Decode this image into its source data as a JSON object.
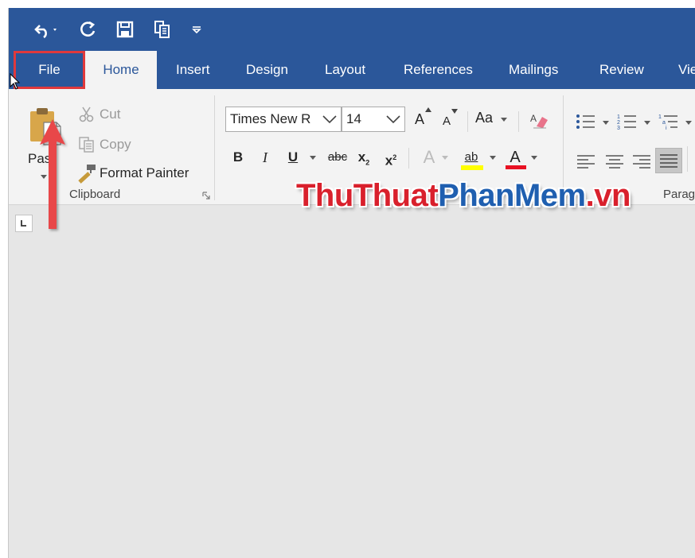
{
  "colors": {
    "title_bar": "#2b579a",
    "ribbon": "#f3f3f3",
    "canvas": "#e6e6e6",
    "annotation_red": "#e0393c"
  },
  "quick_access": {
    "icons": [
      "undo-icon",
      "redo-icon",
      "save-icon",
      "touch-mode-icon",
      "customize-qat-icon"
    ]
  },
  "tabs": [
    {
      "label": "File"
    },
    {
      "label": "Home"
    },
    {
      "label": "Insert"
    },
    {
      "label": "Design"
    },
    {
      "label": "Layout"
    },
    {
      "label": "References"
    },
    {
      "label": "Mailings"
    },
    {
      "label": "Review"
    },
    {
      "label": "Vie"
    }
  ],
  "clipboard": {
    "paste_label": "Pas",
    "cut_label": "Cut",
    "copy_label": "Copy",
    "format_painter_label": "Format Painter",
    "group_label": "Clipboard"
  },
  "font": {
    "font_name": "Times New R",
    "font_size": "14",
    "change_case_label": "Aa",
    "bold": "B",
    "italic": "I",
    "underline": "U",
    "strikethrough": "abc",
    "subscript": "x",
    "superscript": "x",
    "text_effects": "A",
    "highlight": "ab",
    "font_color": "A",
    "grow": "A",
    "shrink": "A"
  },
  "paragraph": {
    "group_label": "Parag"
  },
  "watermark": {
    "part1": "ThuThuat",
    "part2": "PhanMem",
    "part3": ".vn"
  }
}
